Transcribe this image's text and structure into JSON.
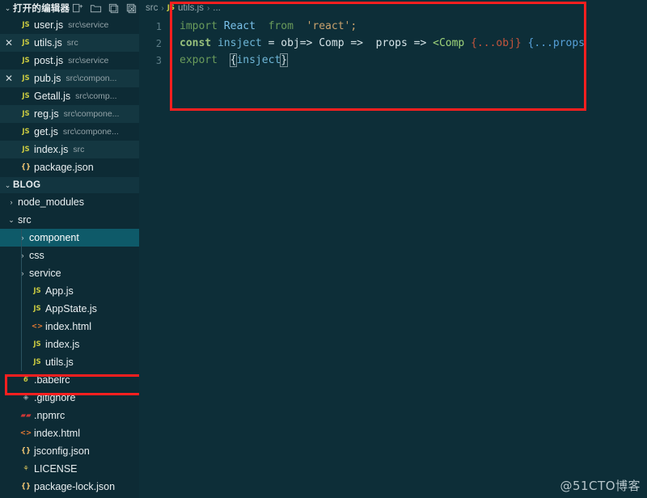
{
  "sidebar": {
    "open_editors": {
      "header_label": "打开的编辑器",
      "chevron": "⌄",
      "actions": [
        {
          "name": "new-file-icon",
          "title": "新建文件"
        },
        {
          "name": "new-folder-icon",
          "title": "新建文件夹"
        },
        {
          "name": "save-all-icon",
          "title": "全部保存"
        },
        {
          "name": "close-all-icon",
          "title": "全部关闭"
        }
      ],
      "items": [
        {
          "close": "",
          "icon": "js",
          "icon_label": "JS",
          "name": "user.js",
          "path": "src\\service"
        },
        {
          "close": "✕",
          "icon": "js",
          "icon_label": "JS",
          "name": "utils.js",
          "path": "src"
        },
        {
          "close": "",
          "icon": "js",
          "icon_label": "JS",
          "name": "post.js",
          "path": "src\\service"
        },
        {
          "close": "✕",
          "icon": "js",
          "icon_label": "JS",
          "name": "pub.js",
          "path": "src\\compon..."
        },
        {
          "close": "",
          "icon": "js",
          "icon_label": "JS",
          "name": "Getall.js",
          "path": "src\\comp..."
        },
        {
          "close": "",
          "icon": "js",
          "icon_label": "JS",
          "name": "reg.js",
          "path": "src\\compone..."
        },
        {
          "close": "",
          "icon": "js",
          "icon_label": "JS",
          "name": "get.js",
          "path": "src\\compone..."
        },
        {
          "close": "",
          "icon": "js",
          "icon_label": "JS",
          "name": "index.js",
          "path": "src"
        },
        {
          "close": "",
          "icon": "json",
          "icon_label": "{}",
          "name": "package.json",
          "path": ""
        }
      ]
    },
    "explorer": {
      "header_label": "BLOG",
      "chevron": "⌄",
      "tree": [
        {
          "arrow": "›",
          "icon": "none",
          "icon_label": "",
          "name": "node_modules",
          "indent": 1,
          "selected": false
        },
        {
          "arrow": "⌄",
          "icon": "none",
          "icon_label": "",
          "name": "src",
          "indent": 1,
          "selected": false
        },
        {
          "arrow": "›",
          "icon": "none",
          "icon_label": "",
          "name": "component",
          "indent": 2,
          "selected": true
        },
        {
          "arrow": "›",
          "icon": "none",
          "icon_label": "",
          "name": "css",
          "indent": 2,
          "selected": false
        },
        {
          "arrow": "›",
          "icon": "none",
          "icon_label": "",
          "name": "service",
          "indent": 2,
          "selected": false
        },
        {
          "arrow": "",
          "icon": "js",
          "icon_label": "JS",
          "name": "App.js",
          "indent": 2,
          "selected": false
        },
        {
          "arrow": "",
          "icon": "js",
          "icon_label": "JS",
          "name": "AppState.js",
          "indent": 2,
          "selected": false
        },
        {
          "arrow": "",
          "icon": "html",
          "icon_label": "<>",
          "name": "index.html",
          "indent": 2,
          "selected": false
        },
        {
          "arrow": "",
          "icon": "js",
          "icon_label": "JS",
          "name": "index.js",
          "indent": 2,
          "selected": false
        },
        {
          "arrow": "",
          "icon": "js",
          "icon_label": "JS",
          "name": "utils.js",
          "indent": 2,
          "selected": false
        },
        {
          "arrow": "",
          "icon": "babel",
          "icon_label": "6",
          "name": ".babelrc",
          "indent": 1,
          "selected": false
        },
        {
          "arrow": "",
          "icon": "git",
          "icon_label": "◈",
          "name": ".gitignore",
          "indent": 1,
          "selected": false
        },
        {
          "arrow": "",
          "icon": "npm",
          "icon_label": "▰▰",
          "name": ".npmrc",
          "indent": 1,
          "selected": false
        },
        {
          "arrow": "",
          "icon": "html",
          "icon_label": "<>",
          "name": "index.html",
          "indent": 1,
          "selected": false
        },
        {
          "arrow": "",
          "icon": "json",
          "icon_label": "{}",
          "name": "jsconfig.json",
          "indent": 1,
          "selected": false
        },
        {
          "arrow": "",
          "icon": "license",
          "icon_label": "⚘",
          "name": "LICENSE",
          "indent": 1,
          "selected": false
        },
        {
          "arrow": "",
          "icon": "json",
          "icon_label": "{}",
          "name": "package-lock.json",
          "indent": 1,
          "selected": false
        }
      ]
    }
  },
  "editor": {
    "breadcrumb": {
      "root": "src",
      "sep": "›",
      "file_icon_label": "JS",
      "file": "utils.js",
      "tail": "..."
    },
    "lines": [
      {
        "num": "1",
        "text": "import React from 'react';"
      },
      {
        "num": "2",
        "text": "const insject = obj=> Comp => props => <Comp {...obj} {...props"
      },
      {
        "num": "3",
        "text": "export {insject}"
      }
    ],
    "tokens": {
      "l1": {
        "import": "import",
        "react": "React",
        "from": "from",
        "str": "'react';"
      },
      "l2": {
        "const": "const",
        "insject": "insject",
        "eq": "=",
        "obj": "obj=>",
        "comp": "Comp",
        "arrow": "=>",
        "props": "props",
        "arrow2": "=>",
        "tag_open": "<Comp",
        "spread_obj": "{...obj}",
        "spread_props": "{...props"
      },
      "l3": {
        "export": "export",
        "open": "{",
        "insject": "insject",
        "close": "}"
      }
    }
  },
  "annotations": {
    "code_box_color": "#ff1f1f",
    "file_box_color": "#ff1f1f"
  },
  "watermark": "@51CTO博客"
}
